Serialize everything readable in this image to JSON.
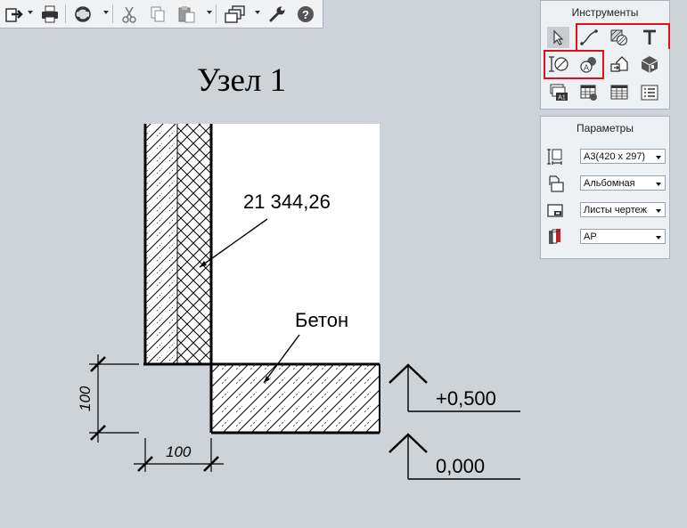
{
  "toolbar": {
    "buttons": [
      {
        "name": "export-icon"
      },
      {
        "name": "print-icon"
      },
      {
        "name": "sync-icon"
      },
      {
        "name": "cut-icon"
      },
      {
        "name": "copy-icon"
      },
      {
        "name": "paste-icon"
      },
      {
        "name": "views-icon"
      },
      {
        "name": "settings-wrench-icon"
      },
      {
        "name": "help-icon"
      }
    ]
  },
  "drawing": {
    "title": "Узел 1",
    "area_label": "21 344,26",
    "material_label": "Бетон",
    "level_top": "+0,500",
    "level_bottom": "0,000",
    "dim_vertical": "100",
    "dim_horizontal": "100"
  },
  "tools_panel": {
    "title": "Инструменты",
    "tools": [
      "select-icon",
      "line-icon",
      "hatch-icon",
      "text-icon",
      "dimension-icon",
      "fill-icon",
      "view-export-icon",
      "3d-view-icon",
      "stamp-icon",
      "table-edit-icon",
      "table-icon",
      "list-icon"
    ]
  },
  "params_panel": {
    "title": "Параметры",
    "rows": [
      {
        "icon": "paper-size-icon",
        "value": "A3(420 x 297)"
      },
      {
        "icon": "orientation-icon",
        "value": "Альбомная"
      },
      {
        "icon": "sheets-icon",
        "value": "Листы чертеж"
      },
      {
        "icon": "layers-icon",
        "value": "АР"
      }
    ]
  },
  "colors": {
    "highlight": "#e0101a",
    "panel": "#eef1f4",
    "background": "#cdd3d9"
  }
}
